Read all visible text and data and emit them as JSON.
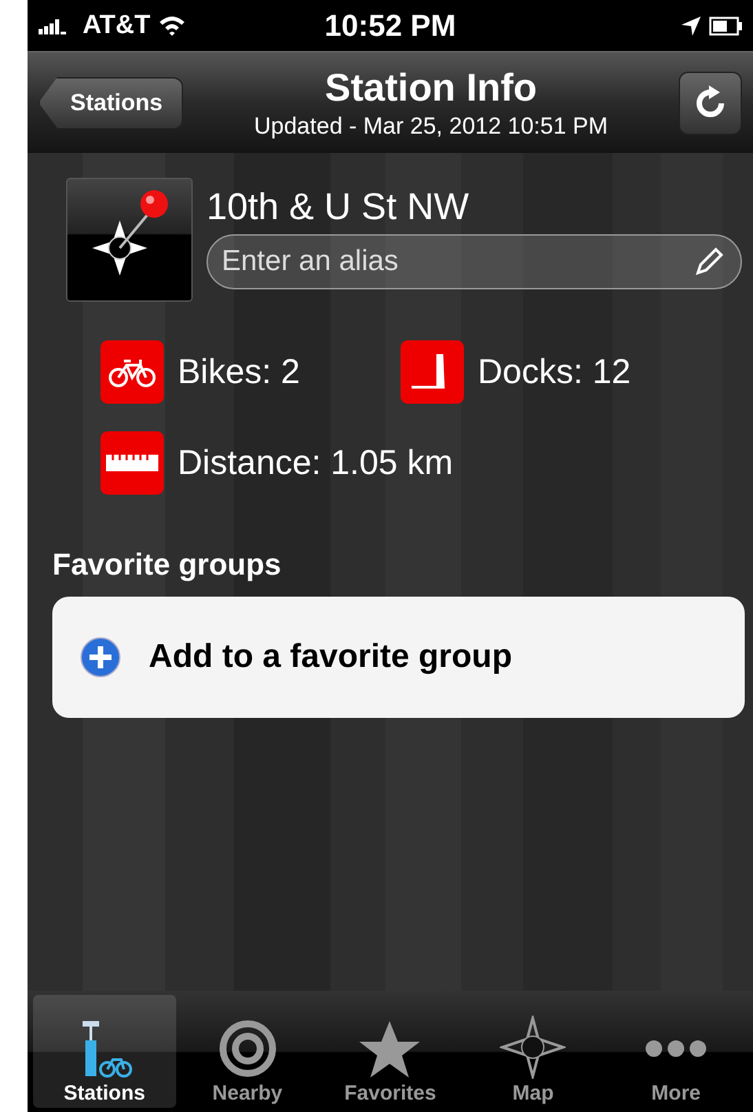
{
  "status_bar": {
    "carrier": "AT&T",
    "time": "10:52 PM"
  },
  "nav": {
    "back": "Stations",
    "title": "Station Info",
    "subtitle": "Updated - Mar 25, 2012 10:51 PM"
  },
  "station": {
    "name": "10th & U St NW",
    "alias": {
      "placeholder": "Enter an alias"
    }
  },
  "stats": [
    {
      "kind": "bikes",
      "label": "Bikes: 2"
    },
    {
      "kind": "docks",
      "label": "Docks: 12"
    },
    {
      "kind": "distance",
      "label": "Distance: 1.05 km"
    }
  ],
  "favorites": {
    "heading": "Favorite groups",
    "action": "Add to a favorite group"
  },
  "tabs": [
    {
      "kind": "stations",
      "label": "Stations",
      "selected": true
    },
    {
      "kind": "nearby",
      "label": "Nearby",
      "selected": false
    },
    {
      "kind": "favorites",
      "label": "Favorites",
      "selected": false
    },
    {
      "kind": "map",
      "label": "Map",
      "selected": false
    },
    {
      "kind": "more",
      "label": "More",
      "selected": false
    }
  ]
}
